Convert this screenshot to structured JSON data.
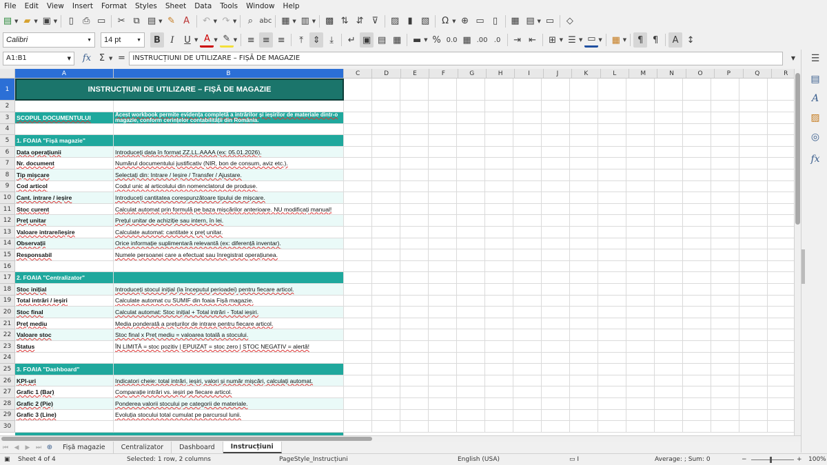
{
  "menu": [
    "File",
    "Edit",
    "View",
    "Insert",
    "Format",
    "Styles",
    "Sheet",
    "Data",
    "Tools",
    "Window",
    "Help"
  ],
  "font": {
    "name": "Calibri",
    "size": "14 pt"
  },
  "name_box": "A1:B1",
  "formula": "INSTRUCȚIUNI DE UTILIZARE – FIȘĂ DE MAGAZIE",
  "columns": [
    "A",
    "B",
    "C",
    "D",
    "E",
    "F",
    "G",
    "H",
    "I",
    "J",
    "K",
    "L",
    "M",
    "N",
    "O",
    "P",
    "Q",
    "R"
  ],
  "rows": [
    {
      "n": "1",
      "type": "title",
      "a": "INSTRUCȚIUNI DE UTILIZARE – FIȘĂ DE MAGAZIE",
      "b": ""
    },
    {
      "n": "2",
      "type": "blank",
      "a": "",
      "b": ""
    },
    {
      "n": "3",
      "type": "scope",
      "a": "SCOPUL DOCUMENTULUI",
      "b": "Acest workbook permite evidența completă a intrărilor și ieșirilor de materiale dintr-o magazie, conform cerințelor contabilității din România."
    },
    {
      "n": "4",
      "type": "blank",
      "a": "",
      "b": ""
    },
    {
      "n": "5",
      "type": "section",
      "a": "1. FOAIA \"Fișă magazie\"",
      "b": ""
    },
    {
      "n": "6",
      "type": "item",
      "a": "Data operațiunii",
      "b": "Introduceți data în format ZZ.LL.AAAA (ex: 05.01.2026)."
    },
    {
      "n": "7",
      "type": "item",
      "a": "Nr. document",
      "b": "Numărul documentului justificativ (NIR, bon de consum, aviz etc.)."
    },
    {
      "n": "8",
      "type": "item",
      "a": "Tip mișcare",
      "b": "Selectați din: Intrare / Ieșire / Transfer / Ajustare."
    },
    {
      "n": "9",
      "type": "item",
      "a": "Cod articol",
      "b": "Codul unic al articolului din nomenclatorul de produse."
    },
    {
      "n": "10",
      "type": "item",
      "a": "Cant. intrare / ieșire",
      "b": "Introduceți cantitatea corespunzătoare tipului de mișcare."
    },
    {
      "n": "11",
      "type": "item",
      "a": "Stoc curent",
      "b": "Calculat automat prin formulă pe baza mișcărilor anterioare. NU modificați manual!"
    },
    {
      "n": "12",
      "type": "item",
      "a": "Preț unitar",
      "b": "Prețul unitar de achiziție sau intern, în lei."
    },
    {
      "n": "13",
      "type": "item",
      "a": "Valoare intrare/ieșire",
      "b": "Calculate automat: cantitate x preț unitar."
    },
    {
      "n": "14",
      "type": "item",
      "a": "Observații",
      "b": "Orice informație suplimentară relevantă (ex: diferență inventar)."
    },
    {
      "n": "15",
      "type": "item",
      "a": "Responsabil",
      "b": "Numele persoanei care a efectuat sau înregistrat operațiunea."
    },
    {
      "n": "16",
      "type": "blank",
      "a": "",
      "b": ""
    },
    {
      "n": "17",
      "type": "section",
      "a": "2. FOAIA \"Centralizator\"",
      "b": ""
    },
    {
      "n": "18",
      "type": "item",
      "a": "Stoc inițial",
      "b": "Introduceți stocul inițial (la începutul perioadei) pentru fiecare articol."
    },
    {
      "n": "19",
      "type": "item",
      "a": "Total intrări / ieșiri",
      "b": "Calculate automat cu SUMIF din foaia Fișă magazie."
    },
    {
      "n": "20",
      "type": "item",
      "a": "Stoc final",
      "b": "Calculat automat: Stoc inițial + Total intrări - Total ieșiri."
    },
    {
      "n": "21",
      "type": "item",
      "a": "Preț mediu",
      "b": "Media ponderată a prețurilor de intrare pentru fiecare articol."
    },
    {
      "n": "22",
      "type": "item",
      "a": "Valoare stoc",
      "b": "Stoc final x Preț mediu = valoarea totală a stocului."
    },
    {
      "n": "23",
      "type": "item",
      "a": "Status",
      "b": "ÎN LIMITĂ = stoc pozitiv | EPUIZAT = stoc zero | STOC NEGATIV = alertă!"
    },
    {
      "n": "24",
      "type": "blank",
      "a": "",
      "b": ""
    },
    {
      "n": "25",
      "type": "section",
      "a": "3. FOAIA \"Dashboard\"",
      "b": ""
    },
    {
      "n": "26",
      "type": "item",
      "a": "KPI-uri",
      "b": "Indicatori cheie: total intrări, ieșiri, valori și număr mișcări, calculați automat."
    },
    {
      "n": "27",
      "type": "item",
      "a": "Grafic 1 (Bar)",
      "b": "Comparație intrări vs. ieșiri pe fiecare articol."
    },
    {
      "n": "28",
      "type": "item",
      "a": "Grafic 2 (Pie)",
      "b": "Ponderea valorii stocului pe categorii de materiale."
    },
    {
      "n": "29",
      "type": "item",
      "a": "Grafic 3 (Line)",
      "b": "Evoluția stocului total cumulat pe parcursul lunii."
    },
    {
      "n": "30",
      "type": "blank",
      "a": "",
      "b": ""
    }
  ],
  "tabs": [
    "Fișă magazie",
    "Centralizator",
    "Dashboard",
    "Instrucțiuni"
  ],
  "active_tab": "Instrucțiuni",
  "status": {
    "sheet": "Sheet 4 of 4",
    "selection": "Selected: 1 row, 2 columns",
    "page_style": "PageStyle_Instrucțiuni",
    "language": "English (USA)",
    "summary": "Average: ; Sum: 0",
    "zoom": "100%"
  },
  "colors": {
    "teal_header": "#1fa89d",
    "title_bg": "#1b756b",
    "row_band": "#eafaf8",
    "selection": "#2b6fd6"
  }
}
